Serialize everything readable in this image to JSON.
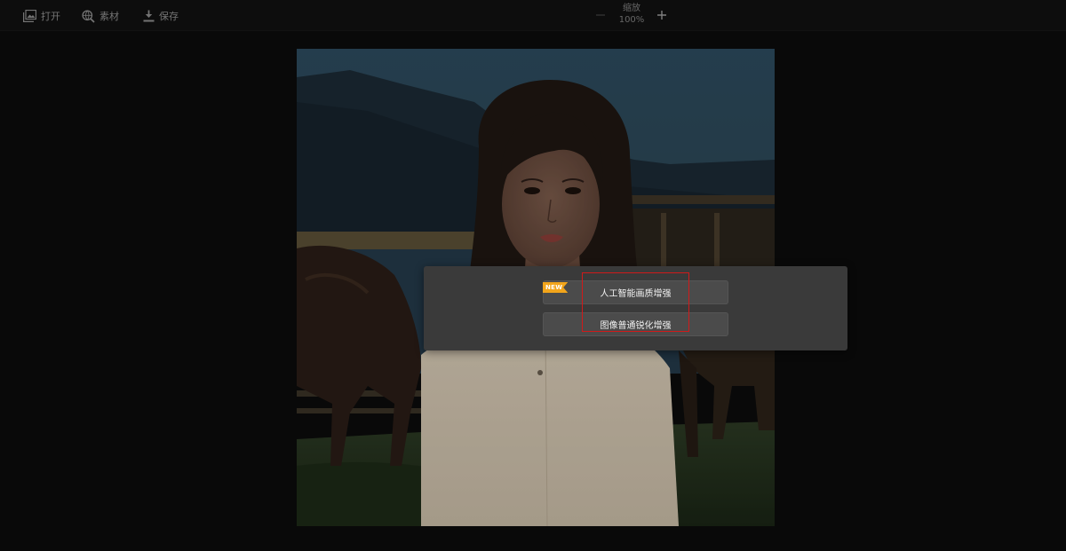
{
  "toolbar": {
    "open_label": "打开",
    "assets_label": "素材",
    "save_label": "保存",
    "zoom_label": "缩放",
    "zoom_value": "100%",
    "zoom_minus": "−",
    "zoom_plus": "+"
  },
  "enhance_panel": {
    "new_badge": "NEW",
    "ai_enhance_label": "人工智能画质增强",
    "sharpen_label": "图像普通锐化增强"
  },
  "colors": {
    "background": "#0b0b0b",
    "toolbar": "#111111",
    "panel": "#3a3a3a",
    "button": "#4b4b4b",
    "badge": "#f2a51b",
    "highlight": "#d11a1a"
  },
  "icons": {
    "open": "image-icon",
    "assets": "magnifier-globe-icon",
    "save": "download-icon"
  }
}
